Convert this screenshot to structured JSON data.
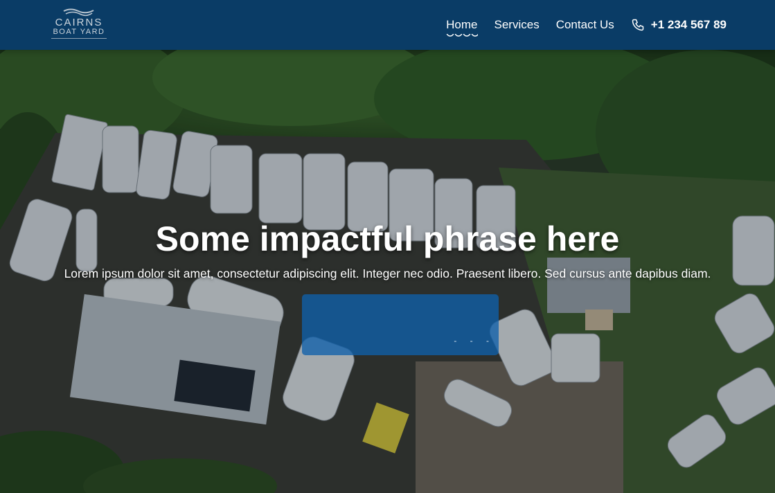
{
  "header": {
    "logo": {
      "line1": "CAIRNS",
      "line2": "BOAT YARD"
    },
    "nav": [
      {
        "label": "Home",
        "active": true
      },
      {
        "label": "Services",
        "active": false
      },
      {
        "label": "Contact Us",
        "active": false
      }
    ],
    "phone": {
      "icon": "phone-icon",
      "number": "+1 234 567 89"
    }
  },
  "hero": {
    "headline": "Some impactful phrase here",
    "subtext": "Lorem ipsum dolor sit amet, consectetur adipiscing elit. Integer nec odio. Praesent libero. Sed cursus ante dapibus diam.",
    "cta": {
      "label": "",
      "dots": "- - -"
    },
    "background": "aerial photo of boat yard with catamarans and trees"
  },
  "colors": {
    "header_bg": "#0a3c66",
    "cta_bg": "#1060aa",
    "text": "#ffffff"
  }
}
